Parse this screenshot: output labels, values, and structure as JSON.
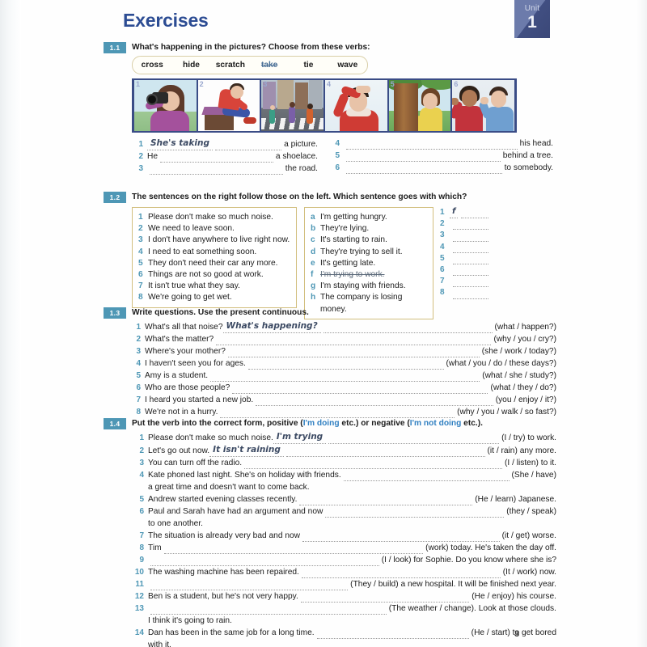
{
  "unit": {
    "label": "Unit",
    "number": "1"
  },
  "page_title": "Exercises",
  "page_number": "3",
  "ex11": {
    "number": "1.1",
    "heading": "What's happening in the pictures?  Choose from these verbs:",
    "verbs": [
      {
        "word": "cross",
        "struck": false
      },
      {
        "word": "hide",
        "struck": false
      },
      {
        "word": "scratch",
        "struck": false
      },
      {
        "word": "take",
        "struck": true
      },
      {
        "word": "tie",
        "struck": false
      },
      {
        "word": "wave",
        "struck": false
      }
    ],
    "pictures": [
      {
        "no": "1",
        "alt": "woman taking a picture with a camera"
      },
      {
        "no": "2",
        "alt": "man tying a shoelace on a stool"
      },
      {
        "no": "3",
        "alt": "people crossing the road on a zebra crossing"
      },
      {
        "no": "4",
        "alt": "man scratching his head"
      },
      {
        "no": "5",
        "alt": "woman hiding behind a tree"
      },
      {
        "no": "6",
        "alt": "two people waving to somebody"
      }
    ],
    "left_items": [
      {
        "no": "1",
        "lead": "",
        "answer": "She's taking",
        "tail": "a picture."
      },
      {
        "no": "2",
        "lead": "He",
        "answer": "",
        "tail": "a shoelace."
      },
      {
        "no": "3",
        "lead": "",
        "answer": "",
        "tail": "the road."
      }
    ],
    "right_items": [
      {
        "no": "4",
        "lead": "",
        "answer": "",
        "tail": "his head."
      },
      {
        "no": "5",
        "lead": "",
        "answer": "",
        "tail": "behind a tree."
      },
      {
        "no": "6",
        "lead": "",
        "answer": "",
        "tail": "to somebody."
      }
    ]
  },
  "ex12": {
    "number": "1.2",
    "heading": "The sentences on the right follow those on the left.  Which sentence goes with which?",
    "left": [
      {
        "key": "1",
        "text": "Please don't make so much noise.",
        "struck": false
      },
      {
        "key": "2",
        "text": "We need to leave soon.",
        "struck": false
      },
      {
        "key": "3",
        "text": "I don't have anywhere to live right now.",
        "struck": false
      },
      {
        "key": "4",
        "text": "I need to eat something soon.",
        "struck": false
      },
      {
        "key": "5",
        "text": "They don't need their car any more.",
        "struck": false
      },
      {
        "key": "6",
        "text": "Things are not so good at work.",
        "struck": false
      },
      {
        "key": "7",
        "text": "It isn't true what they say.",
        "struck": false
      },
      {
        "key": "8",
        "text": "We're going to get wet.",
        "struck": false
      }
    ],
    "right": [
      {
        "key": "a",
        "text": "I'm getting hungry.",
        "struck": false
      },
      {
        "key": "b",
        "text": "They're lying.",
        "struck": false
      },
      {
        "key": "c",
        "text": "It's starting to rain.",
        "struck": false
      },
      {
        "key": "d",
        "text": "They're trying to sell it.",
        "struck": false
      },
      {
        "key": "e",
        "text": "It's getting late.",
        "struck": false
      },
      {
        "key": "f",
        "text": "I'm trying to work.",
        "struck": true
      },
      {
        "key": "g",
        "text": "I'm staying with friends.",
        "struck": false
      },
      {
        "key": "h",
        "text": "The company is losing money.",
        "struck": false
      }
    ],
    "answers": [
      {
        "no": "1",
        "answer": "f"
      },
      {
        "no": "2",
        "answer": ""
      },
      {
        "no": "3",
        "answer": ""
      },
      {
        "no": "4",
        "answer": ""
      },
      {
        "no": "5",
        "answer": ""
      },
      {
        "no": "6",
        "answer": ""
      },
      {
        "no": "7",
        "answer": ""
      },
      {
        "no": "8",
        "answer": ""
      }
    ]
  },
  "ex13": {
    "number": "1.3",
    "heading": "Write questions.  Use the present continuous.",
    "items": [
      {
        "no": "1",
        "lead": "What's all that noise?",
        "answer": "What's happening?",
        "tail": "(what / happen?)"
      },
      {
        "no": "2",
        "lead": "What's the matter?",
        "answer": "",
        "tail": "(why / you / cry?)"
      },
      {
        "no": "3",
        "lead": "Where's your mother?",
        "answer": "",
        "tail": "(she / work / today?)"
      },
      {
        "no": "4",
        "lead": "I haven't seen you for ages.",
        "answer": "",
        "tail": "(what / you / do / these days?)"
      },
      {
        "no": "5",
        "lead": "Amy is a student.",
        "answer": "",
        "tail": "(what / she / study?)"
      },
      {
        "no": "6",
        "lead": "Who are those people?",
        "answer": "",
        "tail": "(what / they / do?)"
      },
      {
        "no": "7",
        "lead": "I heard you started a new job.",
        "answer": "",
        "tail": "(you / enjoy / it?)"
      },
      {
        "no": "8",
        "lead": "We're not in a hurry.",
        "answer": "",
        "tail": "(why / you / walk / so fast?)"
      }
    ]
  },
  "ex14": {
    "number": "1.4",
    "heading_parts": {
      "p1": "Put the verb into the correct form, positive (",
      "hl1": "I'm doing",
      "p2": " etc.) or negative (",
      "hl2": "I'm not doing",
      "p3": " etc.)."
    },
    "items": [
      {
        "no": "1",
        "lead": "Please don't make so much noise.",
        "answer": "I'm trying",
        "tail": "(I / try) to work.",
        "cont": ""
      },
      {
        "no": "2",
        "lead": "Let's go out now.",
        "answer": "It isn't raining",
        "tail": "(it / rain) any more.",
        "cont": ""
      },
      {
        "no": "3",
        "lead": "You can turn off the radio.",
        "answer": "",
        "tail": "(I / listen) to it.",
        "cont": ""
      },
      {
        "no": "4",
        "lead": "Kate phoned last night.  She's on holiday with friends.",
        "answer": "",
        "tail": "(She / have)",
        "cont": "a great time and doesn't want to come back."
      },
      {
        "no": "5",
        "lead": "Andrew started evening classes recently.",
        "answer": "",
        "tail": "(He / learn) Japanese.",
        "cont": ""
      },
      {
        "no": "6",
        "lead": "Paul and Sarah have had an argument and now",
        "answer": "",
        "tail": "(they / speak)",
        "cont": "to one another."
      },
      {
        "no": "7",
        "lead": "The situation is already very bad and now",
        "answer": "",
        "tail": "(it / get) worse.",
        "cont": ""
      },
      {
        "no": "8",
        "lead": "Tim",
        "answer": "",
        "tail": "(work) today.  He's taken the day off.",
        "cont": ""
      },
      {
        "no": "9",
        "lead": "",
        "answer": "",
        "tail": "(I / look) for Sophie.  Do you know where she is?",
        "cont": ""
      },
      {
        "no": "10",
        "lead": "The washing machine has been repaired.",
        "answer": "",
        "tail": "(It / work) now.",
        "cont": ""
      },
      {
        "no": "11",
        "lead": "",
        "answer": "",
        "tail": "(They / build) a new hospital.  It will be finished next year.",
        "cont": ""
      },
      {
        "no": "12",
        "lead": "Ben is a student, but he's not very happy.",
        "answer": "",
        "tail": "(He / enjoy) his course.",
        "cont": ""
      },
      {
        "no": "13",
        "lead": "",
        "answer": "",
        "tail": "(The weather / change).  Look at those clouds.",
        "cont": "I think it's going to rain."
      },
      {
        "no": "14",
        "lead": "Dan has been in the same job for a long time.",
        "answer": "",
        "tail": "(He / start) to get bored",
        "cont": "with it."
      }
    ]
  }
}
